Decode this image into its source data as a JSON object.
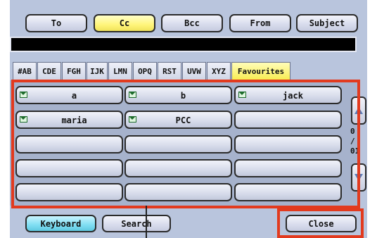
{
  "recipient_tabs": [
    {
      "label": "To",
      "active": false
    },
    {
      "label": "Cc",
      "active": true
    },
    {
      "label": "Bcc",
      "active": false
    },
    {
      "label": "From",
      "active": false
    },
    {
      "label": "Subject",
      "active": false
    }
  ],
  "address_value": "",
  "index_tabs": [
    {
      "label": "#AB",
      "selected": false
    },
    {
      "label": "CDE",
      "selected": false
    },
    {
      "label": "FGH",
      "selected": false
    },
    {
      "label": "IJK",
      "selected": false
    },
    {
      "label": "LMN",
      "selected": false
    },
    {
      "label": "OPQ",
      "selected": false
    },
    {
      "label": "RST",
      "selected": false
    },
    {
      "label": "UVW",
      "selected": false
    },
    {
      "label": "XYZ",
      "selected": false
    },
    {
      "label": "Favourites",
      "selected": true
    }
  ],
  "entries": [
    {
      "name": "a",
      "icon": "email-icon"
    },
    {
      "name": "b",
      "icon": "email-icon"
    },
    {
      "name": "jack",
      "icon": "email-icon"
    },
    {
      "name": "maria",
      "icon": "email-icon"
    },
    {
      "name": "PCC",
      "icon": "email-icon"
    },
    {
      "name": "",
      "icon": ""
    },
    {
      "name": "",
      "icon": ""
    },
    {
      "name": "",
      "icon": ""
    },
    {
      "name": "",
      "icon": ""
    },
    {
      "name": "",
      "icon": ""
    },
    {
      "name": "",
      "icon": ""
    },
    {
      "name": "",
      "icon": ""
    },
    {
      "name": "",
      "icon": ""
    },
    {
      "name": "",
      "icon": ""
    },
    {
      "name": "",
      "icon": ""
    }
  ],
  "pager": {
    "current": "0",
    "separator": "/",
    "total": "01"
  },
  "bottom": {
    "keyboard_label": "Keyboard",
    "search_label": "Search",
    "close_label": "Close"
  },
  "colors": {
    "highlight": "#e23a1e",
    "active_tab": "#fff57a",
    "keyboard": "#7fdef2"
  }
}
